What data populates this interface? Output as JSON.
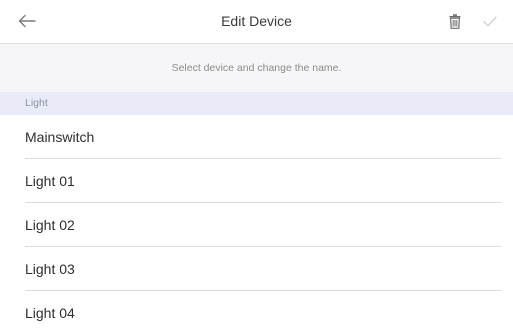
{
  "header": {
    "title": "Edit Device",
    "back_icon": "arrow-left-icon",
    "delete_icon": "trash-icon",
    "confirm_icon": "checkmark-icon"
  },
  "hint": "Select device and change the name.",
  "section": {
    "label": "Light"
  },
  "devices": [
    {
      "name": "Mainswitch"
    },
    {
      "name": "Light 01"
    },
    {
      "name": "Light 02"
    },
    {
      "name": "Light 03"
    },
    {
      "name": "Light 04"
    }
  ],
  "colors": {
    "section_background": "#e9ecf8",
    "section_text": "#8e93a8",
    "hint_background": "#f6f6f8",
    "divider": "#dcdcdc"
  }
}
